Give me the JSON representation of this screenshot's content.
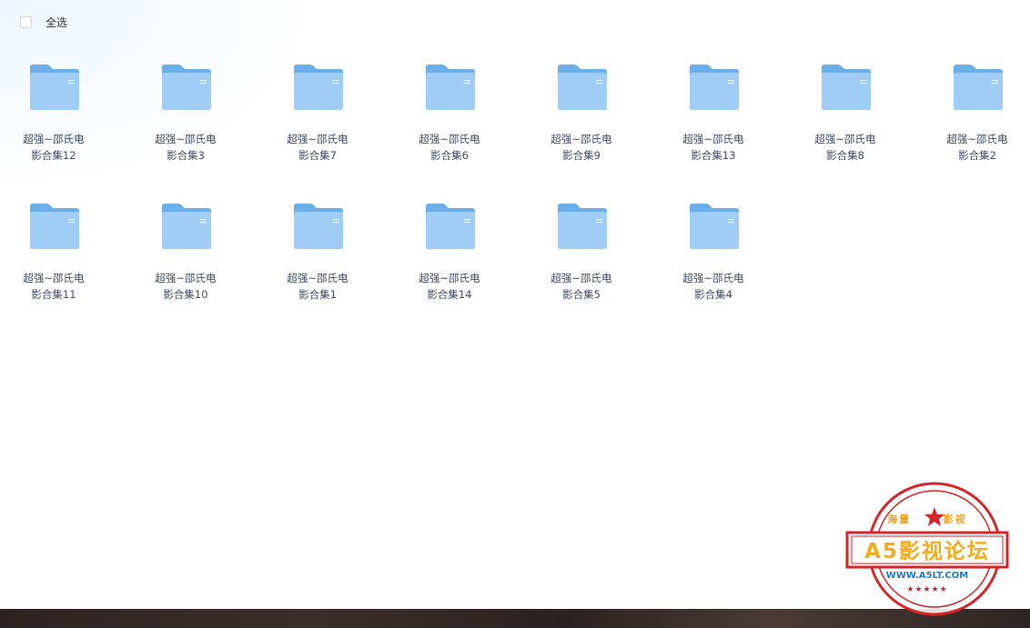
{
  "toolbar": {
    "select_all_label": "全选",
    "select_all_checked": false
  },
  "folders": [
    {
      "line1": "超强~邵氏电",
      "line2": "影合集12"
    },
    {
      "line1": "超强~邵氏电",
      "line2": "影合集3"
    },
    {
      "line1": "超强~邵氏电",
      "line2": "影合集7"
    },
    {
      "line1": "超强~邵氏电",
      "line2": "影合集6"
    },
    {
      "line1": "超强~邵氏电",
      "line2": "影合集9"
    },
    {
      "line1": "超强~邵氏电",
      "line2": "影合集13"
    },
    {
      "line1": "超强~邵氏电",
      "line2": "影合集8"
    },
    {
      "line1": "超强~邵氏电",
      "line2": "影合集2"
    },
    {
      "line1": "超强~邵氏电",
      "line2": "影合集11"
    },
    {
      "line1": "超强~邵氏电",
      "line2": "影合集10"
    },
    {
      "line1": "超强~邵氏电",
      "line2": "影合集1"
    },
    {
      "line1": "超强~邵氏电",
      "line2": "影合集14"
    },
    {
      "line1": "超强~邵氏电",
      "line2": "影合集5"
    },
    {
      "line1": "超强~邵氏电",
      "line2": "影合集4"
    }
  ],
  "folder_icon": "folder-icon",
  "watermark": {
    "top_left": "海量",
    "top_right": "影视",
    "main": "A5影视论坛",
    "url": "WWW.A5LT.COM",
    "stars": "★★★★★"
  },
  "colors": {
    "folder_back": "#6aaeea",
    "folder_front": "#9fcdf6",
    "stamp_red": "#d6262a",
    "stamp_gold": "#f2ac1d",
    "stamp_blue": "#1f79c6"
  }
}
